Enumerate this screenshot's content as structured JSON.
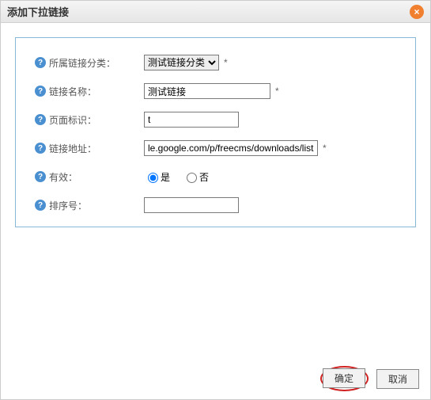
{
  "dialog": {
    "title": "添加下拉链接",
    "close_glyph": "×"
  },
  "form": {
    "help_glyph": "?",
    "required_mark": "*",
    "category": {
      "label": "所属链接分类：",
      "selected": "测试链接分类"
    },
    "name": {
      "label": "链接名称：",
      "value": "测试链接"
    },
    "pageid": {
      "label": "页面标识：",
      "value": "t"
    },
    "url": {
      "label": "链接地址：",
      "value": "le.google.com/p/freecms/downloads/list"
    },
    "enabled": {
      "label": "有效：",
      "yes": "是",
      "no": "否",
      "value": "yes"
    },
    "order": {
      "label": "排序号：",
      "value": ""
    }
  },
  "buttons": {
    "ok": "确定",
    "cancel": "取消"
  }
}
